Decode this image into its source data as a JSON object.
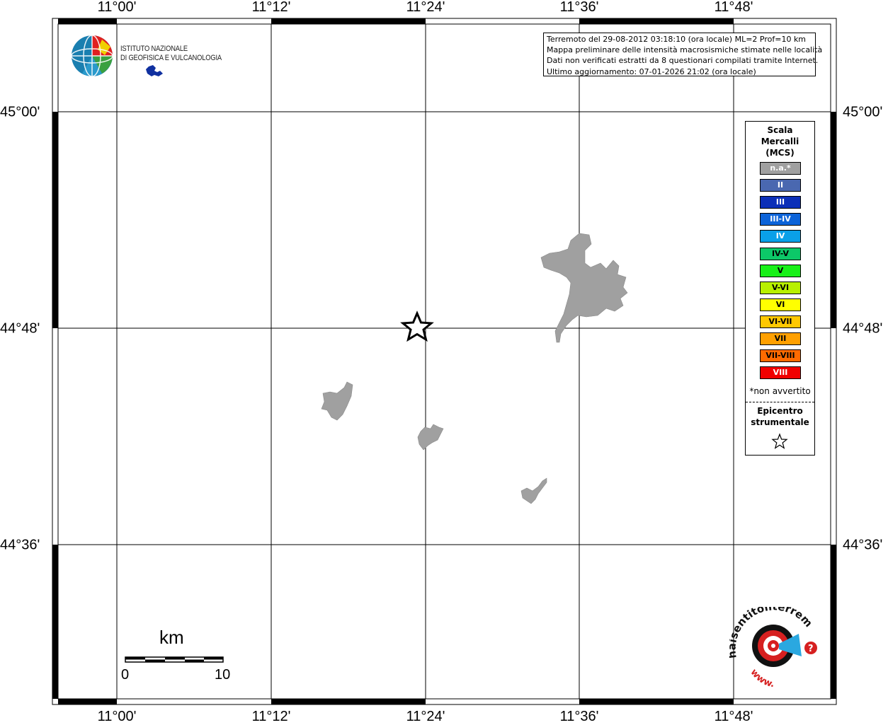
{
  "map": {
    "lon_ticks": [
      "11°00'",
      "11°12'",
      "11°24'",
      "11°36'",
      "11°48'"
    ],
    "lat_ticks": [
      "45°00'",
      "44°48'",
      "44°36'"
    ]
  },
  "info": {
    "line1": "Terremoto del 29-08-2012 03:18:10 (ora locale) ML=2 Prof=10 km",
    "line2": "Mappa preliminare delle intensità macrosismiche stimate nelle località",
    "line3": "Dati non verificati estratti da 8 questionari compilati tramite Internet.",
    "line4": "Ultimo aggiornamento: 07-01-2026 21:02 (ora locale)"
  },
  "logo": {
    "line1": "ISTITUTO NAZIONALE",
    "line2": "DI GEOFISICA E VULCANOLOGIA"
  },
  "legend": {
    "title1": "Scala",
    "title2": "Mercalli",
    "title3": "(MCS)",
    "items": [
      {
        "label": "n.a.*",
        "color": "#a0a0a0",
        "text_color": "#ffffff"
      },
      {
        "label": "II",
        "color": "#4a68b0",
        "text_color": "#ffffff"
      },
      {
        "label": "III",
        "color": "#0c2fb8",
        "text_color": "#ffffff"
      },
      {
        "label": "III-IV",
        "color": "#0c63d8",
        "text_color": "#ffffff"
      },
      {
        "label": "IV",
        "color": "#0aa0e8",
        "text_color": "#ffffff"
      },
      {
        "label": "IV-V",
        "color": "#0cc868",
        "text_color": "#000000"
      },
      {
        "label": "V",
        "color": "#18f018",
        "text_color": "#000000"
      },
      {
        "label": "V-VI",
        "color": "#b8f000",
        "text_color": "#000000"
      },
      {
        "label": "VI",
        "color": "#ffff00",
        "text_color": "#000000"
      },
      {
        "label": "VI-VII",
        "color": "#ffc800",
        "text_color": "#000000"
      },
      {
        "label": "VII",
        "color": "#ffa000",
        "text_color": "#000000"
      },
      {
        "label": "VII-VIII",
        "color": "#ff6a00",
        "text_color": "#000000"
      },
      {
        "label": "VIII",
        "color": "#f00000",
        "text_color": "#ffffff"
      }
    ],
    "note": "*non avvertito",
    "epicenter1": "Epicentro",
    "epicenter2": "strumentale"
  },
  "scale_bar": {
    "unit": "km",
    "start": "0",
    "end": "10"
  },
  "footer_logo": {
    "text": "haisentitoilterremoto.it",
    "prefix": "www."
  },
  "colors": {
    "locality_fill": "#a0a0a0",
    "grid": "#000000"
  }
}
